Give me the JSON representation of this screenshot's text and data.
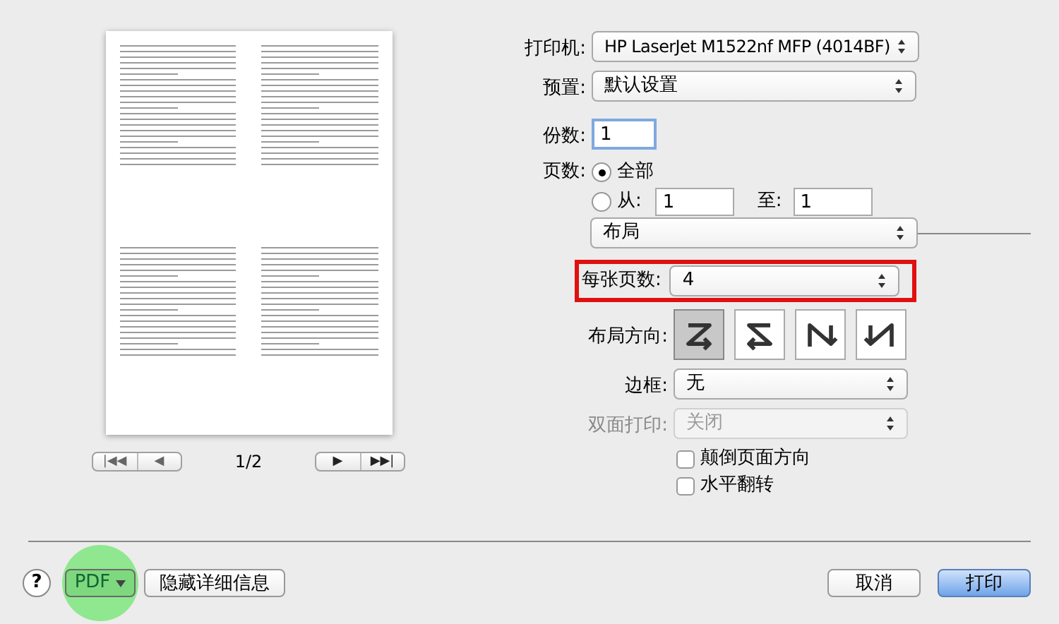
{
  "preview": {
    "page_indicator": "1/2",
    "nav_first": "|◀◀",
    "nav_prev": "◀",
    "nav_next": "▶",
    "nav_last": "▶▶|"
  },
  "printer": {
    "label": "打印机:",
    "value": "HP LaserJet M1522nf MFP (4014BF)"
  },
  "preset": {
    "label": "预置:",
    "value": "默认设置"
  },
  "copies": {
    "label": "份数:",
    "value": "1"
  },
  "pages": {
    "label": "页数:",
    "options": [
      {
        "label": "全部",
        "selected": true
      },
      {
        "label": "从:",
        "selected": false
      }
    ],
    "from": "1",
    "to_label": "至:",
    "to": "1"
  },
  "section": {
    "value": "布局"
  },
  "pages_per_sheet": {
    "label": "每张页数:",
    "value": "4",
    "highlighted": true
  },
  "layout_direction": {
    "label": "布局方向:",
    "options": [
      {
        "kind": "z",
        "selected": true
      },
      {
        "kind": "s",
        "selected": false
      },
      {
        "kind": "n",
        "selected": false
      },
      {
        "kind": "nr",
        "selected": false
      }
    ]
  },
  "border": {
    "label": "边框:",
    "value": "无",
    "disabled": false
  },
  "duplex": {
    "label": "双面打印:",
    "value": "关闭",
    "disabled": true
  },
  "checkboxes": [
    {
      "label": "颠倒页面方向",
      "checked": false
    },
    {
      "label": "水平翻转",
      "checked": false
    }
  ],
  "footer": {
    "help": "?",
    "pdf": "PDF",
    "pdf_highlighted": true,
    "hide_details": "隐藏详细信息",
    "cancel": "取消",
    "print": "打印"
  }
}
